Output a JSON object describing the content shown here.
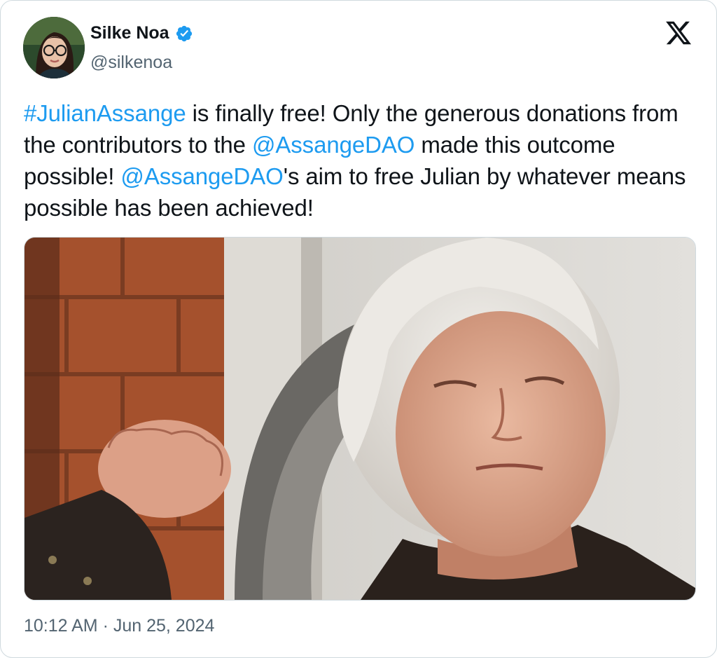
{
  "author": {
    "display_name": "Silke Noa",
    "handle": "@silkenoa",
    "verified_icon": "verified-badge-icon",
    "badge_color": "#1d9bf0"
  },
  "brand": {
    "logo_icon": "x-logo-icon"
  },
  "tweet": {
    "text_segments": [
      {
        "type": "hashtag",
        "text": "#JulianAssange"
      },
      {
        "type": "text",
        "text": " is finally free! Only the generous donations from the contributors to the "
      },
      {
        "type": "mention",
        "text": "@AssangeDAO"
      },
      {
        "type": "text",
        "text": " made this outcome possible! "
      },
      {
        "type": "mention",
        "text": "@AssangeDAO"
      },
      {
        "type": "text",
        "text": "'s aim to free Julian by whatever means possible has been achieved!"
      }
    ],
    "timestamp": "10:12 AM · Jun 25, 2024"
  },
  "colors": {
    "link": "#1d9bf0",
    "secondary_text": "#536471",
    "border": "#cfd9de"
  }
}
